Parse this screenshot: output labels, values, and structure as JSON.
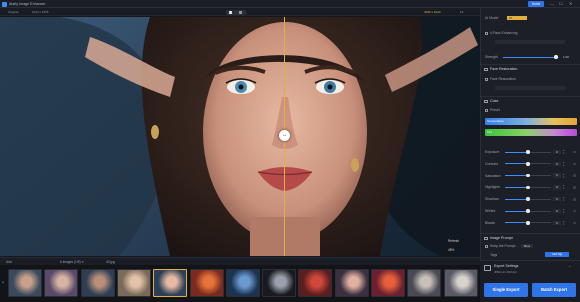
{
  "app": {
    "title": "Aiarty Image Enhancer",
    "home_label": "Home",
    "min": "—",
    "max": "☐",
    "close": "✕"
  },
  "subbar": {
    "left": "Original",
    "dims": "1024 x 1536",
    "right_dims": "4096 x 6144",
    "zoom": "Fit"
  },
  "canvas": {
    "refresh_label": "Refresh",
    "zoom_value": "48%",
    "handle_icon": "↔"
  },
  "filmstrip": {
    "add": "Add",
    "count": "6 Images (1/9) ✕",
    "filename": "42.jpg",
    "thumb_count": 13,
    "selected_index": 4
  },
  "panel": {
    "ai_model_label": "AI Model",
    "ai_model_value": "v2",
    "face_enhance_label": "4-Pass Enhancing",
    "strength_label": "Strength",
    "strength_value": "1.00",
    "strength_level": 0.95,
    "face_restoration": "Face Restoration",
    "face_restoration_opt": "Face Restoration",
    "color": "Color",
    "preset_label": "Preset",
    "grad1": "Temperature",
    "grad2": "Tint",
    "sliders": [
      {
        "label": "Exposure",
        "value": "0",
        "level": 0.5
      },
      {
        "label": "Contrast",
        "value": "0",
        "level": 0.5
      },
      {
        "label": "Saturation",
        "value": "0",
        "level": 0.5
      },
      {
        "label": "Highlights",
        "value": "0",
        "level": 0.5
      },
      {
        "label": "Shadows",
        "value": "0",
        "level": 0.5
      },
      {
        "label": "Whites",
        "value": "0",
        "level": 0.5
      },
      {
        "label": "Blacks",
        "value": "0",
        "level": 0.5
      }
    ],
    "image_prompt": "Image Prompt",
    "keep_pose": "Keep the Prompt",
    "more": "More",
    "tags": "Tags",
    "add_tag": "Add Tag",
    "export_title": "Export Settings",
    "export_sub": "JPEG 2x 300 dpi",
    "single_export": "Single Export",
    "batch_export": "Batch Export"
  },
  "colors": {
    "accent": "#2f74e8",
    "split": "#e0b040"
  }
}
